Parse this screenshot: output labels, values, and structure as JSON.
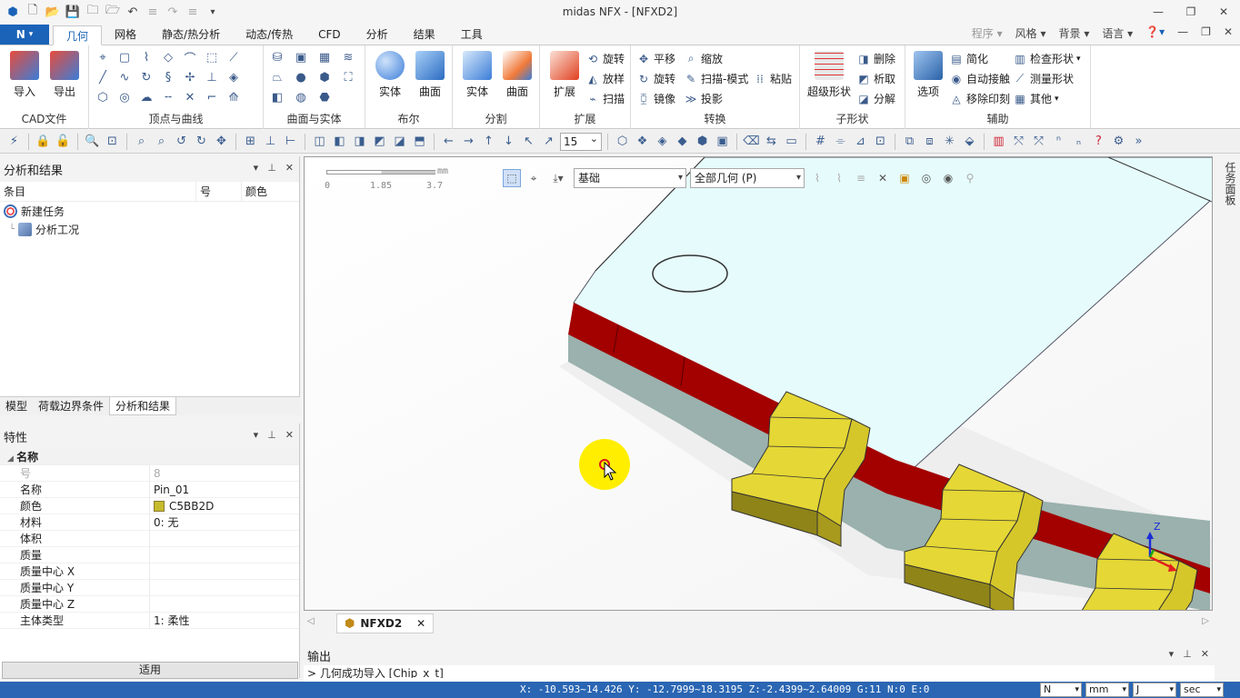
{
  "window": {
    "title": "midas NFX - [NFXD2]"
  },
  "ribbon": {
    "app_button": "N",
    "tabs": [
      "几何",
      "网格",
      "静态/热分析",
      "动态/传热",
      "CFD",
      "分析",
      "结果",
      "工具"
    ],
    "active_tab": "几何",
    "right_items": [
      "程序",
      "风格",
      "背景",
      "语言"
    ],
    "groups": {
      "cad": {
        "label": "CAD文件",
        "import": "导入",
        "export": "导出"
      },
      "points_curves": {
        "label": "顶点与曲线"
      },
      "surfaces_solids": {
        "label": "曲面与实体"
      },
      "boolean": {
        "label": "布尔",
        "solid": "实体",
        "surface": "曲面"
      },
      "split": {
        "label": "分割",
        "solid": "实体",
        "surface": "曲面"
      },
      "extend": {
        "label": "扩展",
        "extend": "扩展",
        "revolve": "旋转",
        "loft": "放样",
        "sweep": "扫描"
      },
      "transform": {
        "label": "转换",
        "translate": "平移",
        "scale": "缩放",
        "rotate": "旋转",
        "sweep_mode": "扫描-模式",
        "paste": "粘贴",
        "mirror": "镜像",
        "project": "投影"
      },
      "subshape": {
        "label": "子形状",
        "super_shape": "超级形状",
        "delete": "删除",
        "explode": "析取",
        "decompose": "分解"
      },
      "aux": {
        "label": "辅助",
        "options": "选项",
        "simplify": "简化",
        "auto_connect": "自动接触",
        "remove_imprint": "移除印刻",
        "check_shape": "检查形状",
        "measure_shape": "测量形状",
        "other": "其他"
      }
    }
  },
  "toolbar": {
    "zoom_value": "15"
  },
  "tree_panel": {
    "title": "分析和结果",
    "columns": [
      "条目",
      "号",
      "颜色"
    ],
    "items": [
      {
        "label": "新建任务"
      },
      {
        "label": "分析工况"
      }
    ],
    "tabs": [
      "模型",
      "荷载边界条件",
      "分析和结果"
    ],
    "active_tab": "分析和结果"
  },
  "properties": {
    "title": "特性",
    "group": "名称",
    "rows": [
      {
        "key": "号",
        "value": "8",
        "disabled": true
      },
      {
        "key": "名称",
        "value": "Pin_01"
      },
      {
        "key": "颜色",
        "value": "C5BB2D",
        "swatch": "#C5BB2D"
      },
      {
        "key": "材料",
        "value": "0: 无"
      },
      {
        "key": "体积",
        "value": ""
      },
      {
        "key": "质量",
        "value": ""
      },
      {
        "key": "质量中心 X",
        "value": ""
      },
      {
        "key": "质量中心 Y",
        "value": ""
      },
      {
        "key": "质量中心 Z",
        "value": ""
      },
      {
        "key": "主体类型",
        "value": "1: 柔性"
      }
    ],
    "apply": "适用"
  },
  "viewport": {
    "scale_unit": "mm",
    "scale_ticks": [
      "0",
      "1.85",
      "3.7"
    ],
    "filter_select": "基础",
    "geometry_select": "全部几何 (P)",
    "axis_label": "Z",
    "colors": {
      "plate": "#e6fbfb",
      "plate_side": "#9ab1ad",
      "strip": "#a30000",
      "pin": "#e5d735",
      "pin_dark": "#8f8418",
      "cursor": "#ffee00"
    }
  },
  "side_tab": "任务面板",
  "doc_tab": "NFXD2",
  "output": {
    "title": "输出",
    "line": "> 几何成功导入 [Chip_x_t]"
  },
  "status": {
    "coords": "X: -10.593~14.426 Y: -12.7999~18.3195 Z:-2.4399~2.64009 G:11  N:0  E:0",
    "unit_force": "N",
    "unit_length": "mm",
    "unit_energy": "J",
    "unit_time": "sec"
  }
}
